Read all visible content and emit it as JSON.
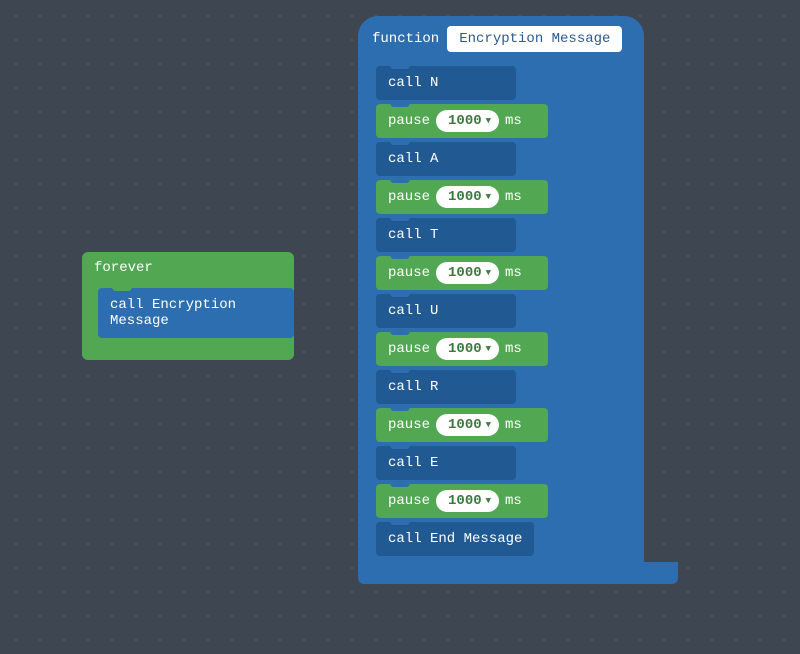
{
  "forever": {
    "label": "forever",
    "call_label": "call Encryption Message"
  },
  "func": {
    "keyword": "function",
    "name": "Encryption Message",
    "stmts": [
      {
        "kind": "call",
        "text": "call N"
      },
      {
        "kind": "pause",
        "label": "pause",
        "value": "1000",
        "unit": "ms"
      },
      {
        "kind": "call",
        "text": "call A"
      },
      {
        "kind": "pause",
        "label": "pause",
        "value": "1000",
        "unit": "ms"
      },
      {
        "kind": "call",
        "text": "call T"
      },
      {
        "kind": "pause",
        "label": "pause",
        "value": "1000",
        "unit": "ms"
      },
      {
        "kind": "call",
        "text": "call U"
      },
      {
        "kind": "pause",
        "label": "pause",
        "value": "1000",
        "unit": "ms"
      },
      {
        "kind": "call",
        "text": "call R"
      },
      {
        "kind": "pause",
        "label": "pause",
        "value": "1000",
        "unit": "ms"
      },
      {
        "kind": "call",
        "text": "call E"
      },
      {
        "kind": "pause",
        "label": "pause",
        "value": "1000",
        "unit": "ms"
      },
      {
        "kind": "call",
        "text": "call End Message"
      }
    ]
  }
}
